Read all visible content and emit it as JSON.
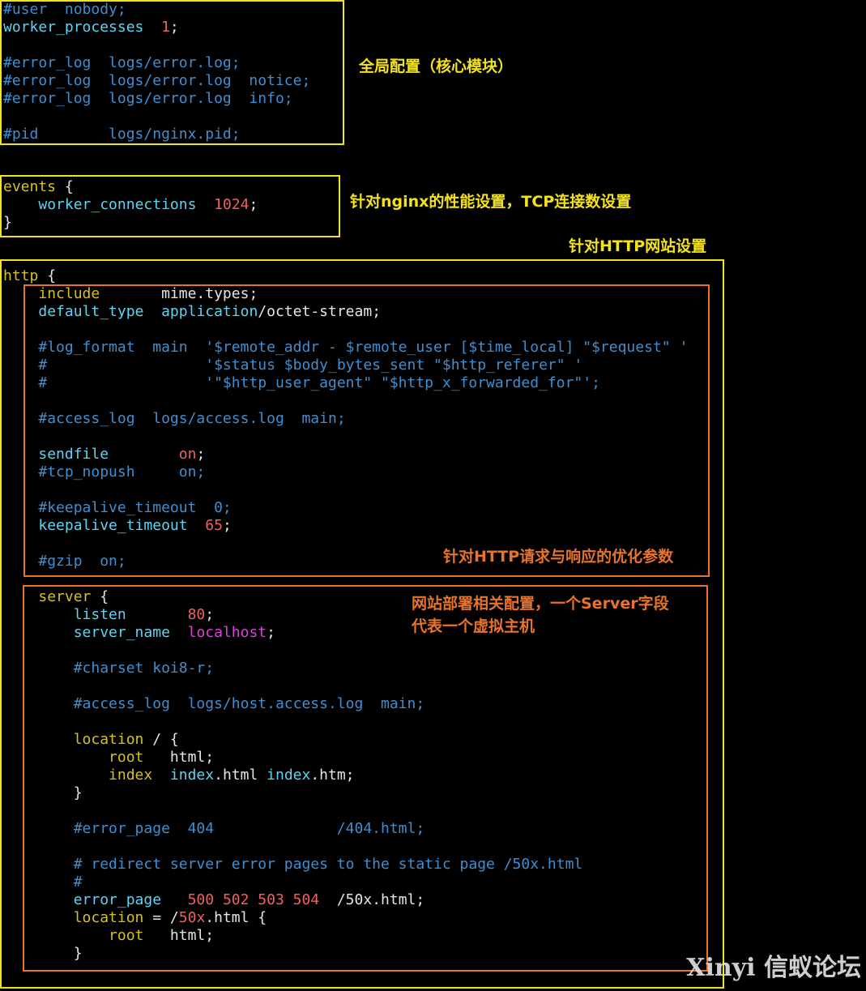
{
  "annotations": {
    "global": "全局配置（核心模块）",
    "events": "针对nginx的性能设置，TCP连接数设置",
    "http": "针对HTTP网站设置",
    "http_opt": "针对HTTP请求与响应的优化参数",
    "server_line1": "网站部署相关配置，一个Server字段",
    "server_line2": "代表一个虚拟主机"
  },
  "code": {
    "g1": "#user  nobody;",
    "g2_dir": "worker_processes",
    "g2_val": "1",
    "g3": "#error_log  logs/error.log;",
    "g4": "#error_log  logs/error.log  notice;",
    "g5": "#error_log  logs/error.log  info;",
    "g6": "#pid        logs/nginx.pid;",
    "e1_kw": "events",
    "e2_dir": "worker_connections",
    "e2_val": "1024",
    "h1_kw": "http",
    "h2_dir": "include",
    "h2_val": "mime.types;",
    "h3_dir": "default_type",
    "h3_val1": "application",
    "h3_val2": "/octet-stream;",
    "h4": "#log_format  main  '$remote_addr - $remote_user [$time_local] \"$request\" '",
    "h5": "#                  '$status $body_bytes_sent \"$http_referer\" '",
    "h6": "#                  '\"$http_user_agent\" \"$http_x_forwarded_for\"';",
    "h7": "#access_log  logs/access.log  main;",
    "h8_dir": "sendfile",
    "h8_val": "on",
    "h9": "#tcp_nopush     on;",
    "h10": "#keepalive_timeout  0;",
    "h11_dir": "keepalive_timeout",
    "h11_val": "65",
    "h12": "#gzip  on;",
    "s1_kw": "server",
    "s2_dir": "listen",
    "s2_val": "80",
    "s3_dir": "server_name",
    "s3_val": "localhost",
    "s4": "#charset koi8-r;",
    "s5": "#access_log  logs/host.access.log  main;",
    "s6_kw": "location",
    "s6_path": "/ {",
    "s7_dir": "root",
    "s7_val": "html;",
    "s8_dir": "index",
    "s8_a": "index",
    "s8_b": ".html ",
    "s8_c": "index",
    "s8_d": ".htm;",
    "s9": "#error_page  404              /404.html;",
    "s10": "# redirect server error pages to the static page /50x.html",
    "s11": "#",
    "s12_dir": "error_page",
    "s12_val": "500 502 503 504",
    "s12_path": "/50x.html;",
    "s13_kw": "location",
    "s13_eq": "= /",
    "s13_num": "50x",
    "s13_rest": ".html {",
    "s14_dir": "root",
    "s14_val": "html;"
  },
  "watermark": "Xinyi 信蚁论坛",
  "colors": {
    "global_box": "#f4e21b",
    "section_box": "#e8732a",
    "comment": "#3f8fd0",
    "keyword": "#d7c01f",
    "directive": "#5fd3f3",
    "number": "#f06060"
  }
}
